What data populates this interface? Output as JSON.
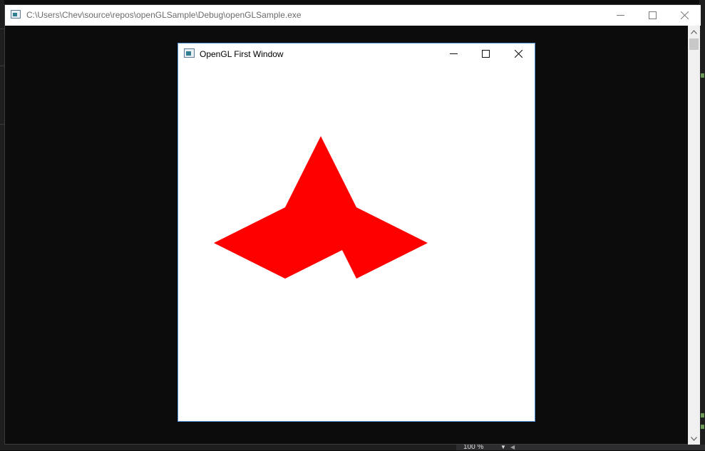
{
  "console_window": {
    "title": "C:\\Users\\Chev\\source\\repos\\openGLSample\\Debug\\openGLSample.exe",
    "icon": "console-app-icon"
  },
  "gl_window": {
    "title": "OpenGL First Window",
    "icon": "gl-app-icon",
    "shape_color": "#ff0000",
    "background_color": "#ffffff"
  },
  "status_bar": {
    "zoom": "100 %"
  }
}
